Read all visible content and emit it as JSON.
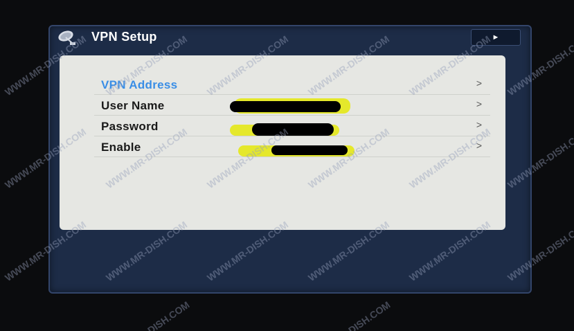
{
  "window": {
    "title": "VPN Setup",
    "play_symbol": "►",
    "icon": "satellite-dish-icon"
  },
  "menu": {
    "items": [
      {
        "label": "VPN Address",
        "selected": true,
        "arrow": ">"
      },
      {
        "label": "User Name",
        "selected": false,
        "arrow": ">"
      },
      {
        "label": "Password",
        "selected": false,
        "arrow": ">"
      },
      {
        "label": "Enable",
        "selected": false,
        "arrow": ">"
      }
    ]
  },
  "watermark": {
    "text": "WWW.MR-DISH.COM",
    "partial_text": "DISH.COM"
  },
  "colors": {
    "selected_text": "#3a8ee6",
    "panel": "#e6e7e3",
    "window": "#1d2c47"
  }
}
